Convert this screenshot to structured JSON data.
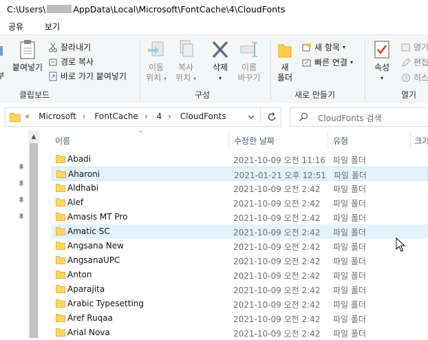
{
  "window": {
    "path_prefix": "C:\\Users\\",
    "path_suffix": "AppData\\Local\\Microsoft\\FontCache\\4\\CloudFonts"
  },
  "menu": {
    "share": "공유",
    "view": "보기"
  },
  "ribbon": {
    "clipboard": {
      "paste": "붙여넣기",
      "cut": "잘라내기",
      "copy_path": "경로 복사",
      "paste_shortcut": "바로 가기 붙여넣기",
      "label": "클립보드"
    },
    "organize": {
      "move_to_1": "이동",
      "move_to_2": "위치",
      "copy_to_1": "복사",
      "copy_to_2": "위치",
      "delete": "삭제",
      "rename_1": "이름",
      "rename_2": "바꾸기",
      "label": "구성"
    },
    "new": {
      "new_folder_1": "새",
      "new_folder_2": "폴더",
      "new_item": "새 항목",
      "easy_access": "빠른 연결",
      "label": "새로 만들기"
    },
    "open": {
      "properties": "속성",
      "open": "열기",
      "edit": "편집",
      "history": "히스",
      "label": "열기"
    }
  },
  "address": {
    "overflow": "«",
    "crumbs": [
      "Microsoft",
      "FontCache",
      "4",
      "CloudFonts"
    ],
    "search_placeholder": "CloudFonts 검색"
  },
  "columns": {
    "name": "이름",
    "date": "수정한 날짜",
    "type": "유형",
    "size": "크기"
  },
  "files": [
    {
      "name": "Abadi",
      "date": "2021-10-09 오전 11:16",
      "type": "파일 폴더"
    },
    {
      "name": "Aharoni",
      "date": "2021-01-21 오후 12:51",
      "type": "파일 폴더"
    },
    {
      "name": "Aldhabi",
      "date": "2021-10-09 오전 2:42",
      "type": "파일 폴더"
    },
    {
      "name": "Alef",
      "date": "2021-10-09 오전 2:42",
      "type": "파일 폴더"
    },
    {
      "name": "Amasis MT Pro",
      "date": "2021-10-09 오전 2:42",
      "type": "파일 폴더"
    },
    {
      "name": "Amatic SC",
      "date": "2021-10-09 오전 2:42",
      "type": "파일 폴더"
    },
    {
      "name": "Angsana New",
      "date": "2021-10-09 오전 2:42",
      "type": "파일 폴더"
    },
    {
      "name": "AngsanaUPC",
      "date": "2021-10-09 오전 2:42",
      "type": "파일 폴더"
    },
    {
      "name": "Anton",
      "date": "2021-10-09 오전 2:42",
      "type": "파일 폴더"
    },
    {
      "name": "Aparajita",
      "date": "2021-10-09 오전 2:42",
      "type": "파일 폴더"
    },
    {
      "name": "Arabic Typesetting",
      "date": "2021-10-09 오전 2:42",
      "type": "파일 폴더"
    },
    {
      "name": "Aref Ruqaa",
      "date": "2021-10-09 오전 2:42",
      "type": "파일 폴더"
    },
    {
      "name": "Arial Nova",
      "date": "2021-10-09 오전 2:42",
      "type": "파일 폴더"
    }
  ],
  "colors": {
    "folder": "#ffd75e",
    "selection": "#cce8ff",
    "hover": "#e5f3ff",
    "header_text": "#4c607a"
  }
}
